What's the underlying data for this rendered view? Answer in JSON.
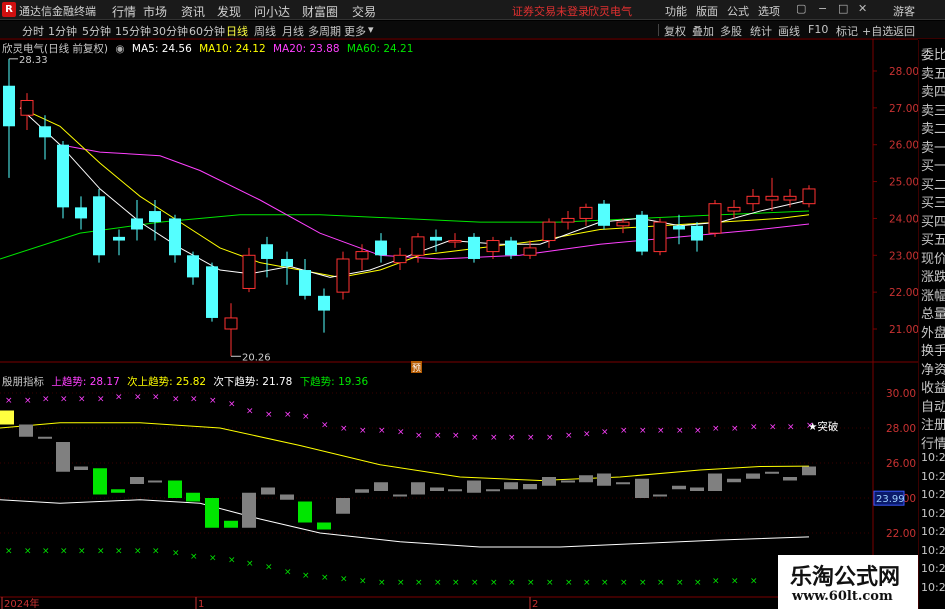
{
  "titlebar": {
    "logo": "R",
    "app_title": "通达信金融终端",
    "menu": [
      "行情",
      "市场",
      "资讯",
      "发现",
      "问小达",
      "财富圈",
      "交易"
    ],
    "login_status": "证券交易未登录",
    "stock_name": "欣灵电气",
    "buttons": [
      "功能",
      "版面",
      "公式",
      "选项"
    ],
    "guest": "游客"
  },
  "toolbar": {
    "periods": [
      "分时",
      "1分钟",
      "5分钟",
      "15分钟",
      "30分钟",
      "60分钟",
      "日线",
      "周线",
      "月线",
      "多周期",
      "更多"
    ],
    "active_period": "日线",
    "right_tools": [
      "复权",
      "叠加",
      "多股",
      "统计",
      "画线",
      "F10",
      "标记",
      "+自选",
      "返回"
    ]
  },
  "main_panel": {
    "stock_label": "欣灵电气(日线 前复权)",
    "ma5": "MA5: 24.56",
    "ma10": "MA10: 24.12",
    "ma20": "MA20: 23.88",
    "ma60": "MA60: 24.21",
    "high_marker": "28.33",
    "low_marker": "20.26",
    "flag_label": "预",
    "price_axis": [
      "28.00",
      "27.00",
      "26.00",
      "25.00",
      "24.00",
      "23.00",
      "22.00",
      "21.00"
    ]
  },
  "indicator_panel": {
    "name": "殷朋指标",
    "up_trend": "上趋势: 28.17",
    "sub_up_trend": "次上趋势: 25.82",
    "sub_down_trend": "次下趋势: 21.78",
    "down_trend": "下趋势: 19.36",
    "breakout_label": "★突破",
    "axis": [
      "30.00",
      "28.00",
      "26.00",
      "24.00",
      "22.00"
    ],
    "current_value": "23.99"
  },
  "date_axis": [
    "2024年",
    "1",
    "2"
  ],
  "right_panel": [
    "委比",
    "卖五",
    "卖四",
    "卖三",
    "卖二",
    "卖一",
    "买一",
    "买二",
    "买三",
    "买四",
    "买五",
    "现价",
    "涨跌",
    "涨幅",
    "总量",
    "外盘",
    "换手",
    "净资",
    "收益",
    "自动",
    "注册",
    "行情",
    "10:20",
    "10:20",
    "10:20",
    "10:20",
    "10:20",
    "10:21",
    "10:21",
    "10:21"
  ],
  "watermark": {
    "title": "乐淘公式网",
    "url": "www.60lt.com"
  },
  "colors": {
    "up": "#ff3232",
    "down": "#54ffff",
    "ma5": "#ffffff",
    "ma10": "#ffff00",
    "ma20": "#ff40ff",
    "ma60": "#00e600",
    "trend_up": "#ff40ff",
    "trend_down": "#00e600"
  }
}
